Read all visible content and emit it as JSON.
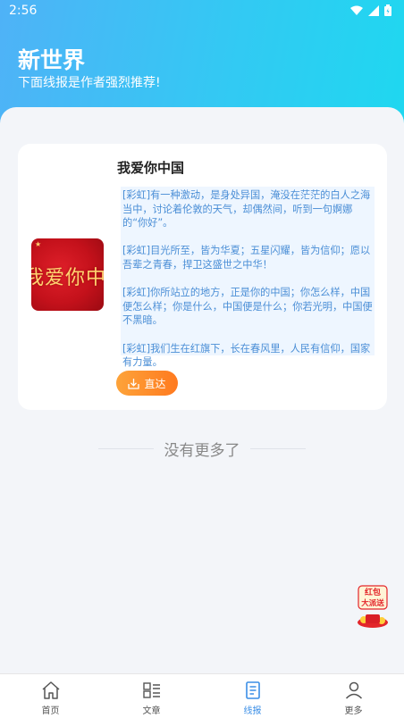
{
  "status_bar": {
    "time": "2:56"
  },
  "header": {
    "title": "新世界",
    "subtitle": "下面线报是作者强烈推荐!"
  },
  "card": {
    "title": "我爱你中国",
    "cover_text": "我爱你中国",
    "paragraphs": [
      "[彩虹]有一种激动，是身处异国，淹没在茫茫的白人之海当中，讨论着伦敦的天气，却偶然间，听到一句婀娜的“你好”。",
      "[彩虹]目光所至，皆为华夏；五星闪耀，皆为信仰；愿以吾辈之青春，捍卫这盛世之中华！",
      "[彩虹]你所站立的地方，正是你的中国；你怎么样，中国便怎么样；你是什么，中国便是什么；你若光明，中国便不黑暗。",
      "[彩虹]我们生在红旗下，长在春风里，人民有信仰，国家有力量。"
    ],
    "button_label": "直达"
  },
  "footer_message": "没有更多了",
  "red_packet": {
    "line1": "红包",
    "line2": "大派送"
  },
  "tabs": [
    {
      "label": "首页",
      "icon": "home-icon",
      "active": false
    },
    {
      "label": "文章",
      "icon": "article-list-icon",
      "active": false
    },
    {
      "label": "线报",
      "icon": "document-icon",
      "active": true
    },
    {
      "label": "更多",
      "icon": "user-icon",
      "active": false
    }
  ],
  "colors": {
    "header_gradient_start": "#4fb2f7",
    "header_gradient_end": "#1ed8f0",
    "accent_blue": "#3a8ee6",
    "button_orange": "#ff7a1f",
    "desc_background": "#eef6ff"
  }
}
